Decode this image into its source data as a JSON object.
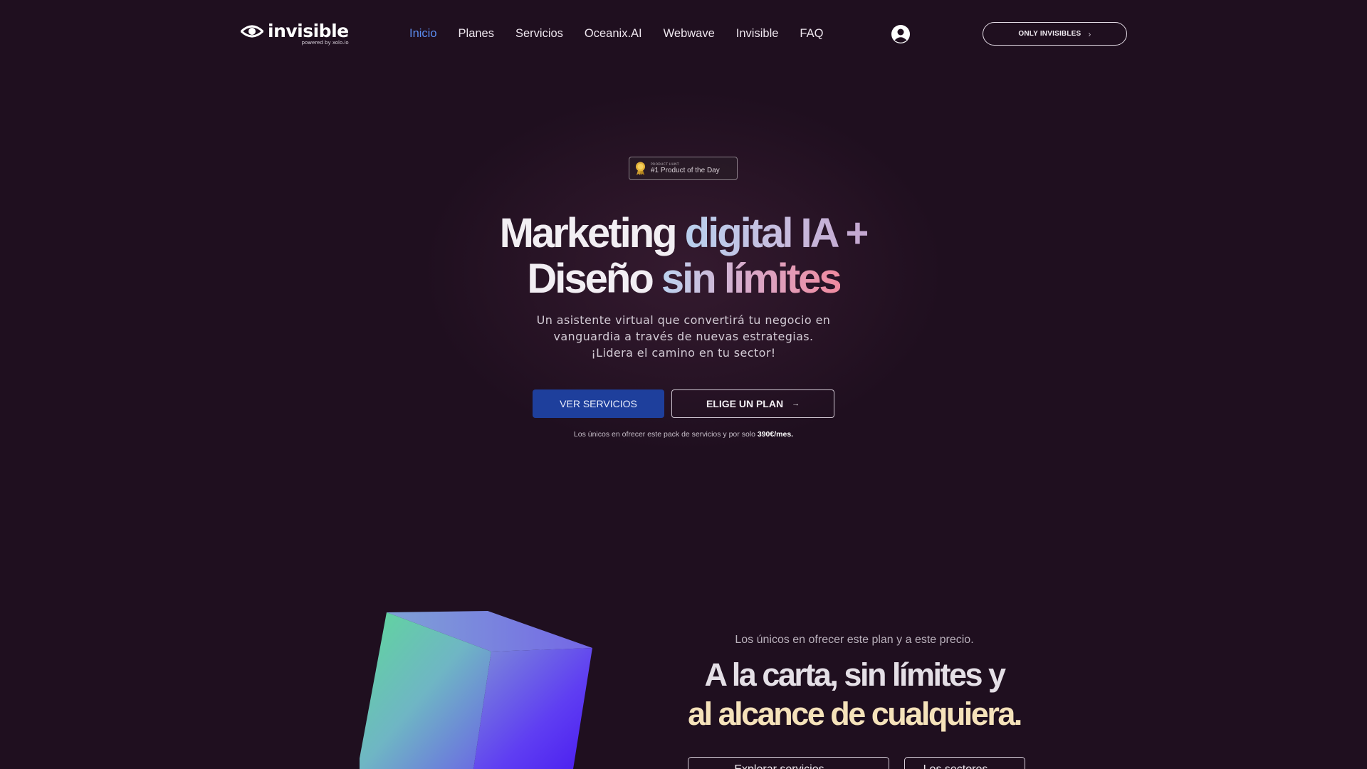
{
  "nav": {
    "logo_word": "invisible",
    "logo_sub": "powered by xolo.io",
    "items": [
      {
        "label": "Inicio",
        "active": true
      },
      {
        "label": "Planes"
      },
      {
        "label": "Servicios"
      },
      {
        "label": "Oceanix.AI"
      },
      {
        "label": "Webwave"
      },
      {
        "label": "Invisible"
      },
      {
        "label": "FAQ"
      }
    ],
    "user_icon": "user-circle-icon",
    "cta_label": "ONLY INVISIBLES",
    "cta_icon": "chevron-right-icon"
  },
  "badge": {
    "small": "PRODUCT HUNT",
    "main": "#1 Product of the Day",
    "icon": "medal-icon"
  },
  "hero": {
    "title_part1": "Marketing ",
    "title_part2": "digital IA +",
    "title_part3": "Diseño ",
    "title_part4": "sin límites",
    "subtitle_line1": "Un asistente virtual que convertirá tu negocio en",
    "subtitle_line2": "vanguardia a través de nuevas estrategias.",
    "subtitle_line3": "¡Lidera el camino en tu sector!",
    "primary_button": "VER SERVICIOS",
    "secondary_button": "ELIGE UN PLAN",
    "secondary_arrow": "→",
    "note_text": "Los únicos en ofrecer este pack de servicios y por solo ",
    "note_price": "390€/mes."
  },
  "section2": {
    "small": "Los únicos en ofrecer este plan y a este precio.",
    "title_line1": "A la carta, sin límites y",
    "title_line2": "al alcance de cualquiera.",
    "button1": "Explorar servicios",
    "button2": "Los sectores",
    "button_arrow": "→"
  },
  "colors": {
    "background": "#1f0f1f",
    "active_link": "#5b8cf0",
    "primary_button": "#1e3f9c",
    "accent_cream": "#f5e2ba"
  }
}
